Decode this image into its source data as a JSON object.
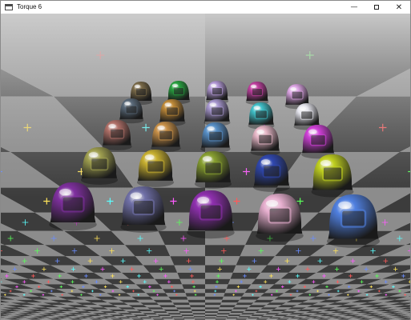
{
  "window": {
    "title": "Torque 6",
    "controls": {
      "minimize_icon": "minimize-icon",
      "maximize_icon": "maximize-icon",
      "close_icon": "close-icon"
    }
  },
  "scene": {
    "description_icons": {
      "floor": "checkerboard-floor",
      "markers": "plus-marker"
    },
    "colors": {
      "sky": "#d0d0d0",
      "floor_dark": "#3c3c3c",
      "floor_light": "#8c8c8c"
    }
  }
}
